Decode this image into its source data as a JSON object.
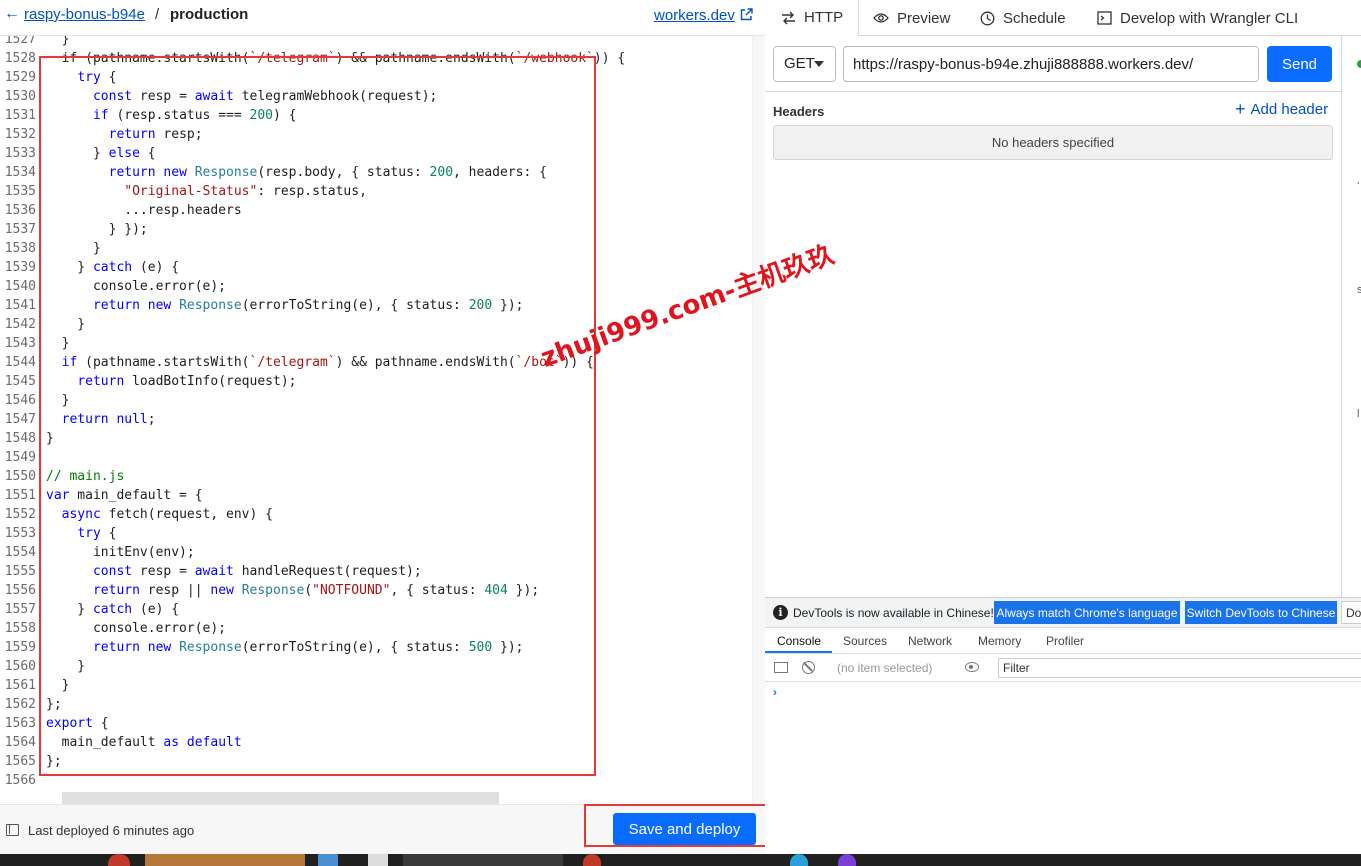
{
  "editor": {
    "worker_name": "raspy-bonus-b94e",
    "breadcrumb_separator": "/",
    "environment": "production",
    "workers_dev_link": "workers.dev",
    "lines": [
      {
        "n": "1527",
        "segs": [
          [
            "  }",
            "t"
          ]
        ]
      },
      {
        "n": "1528",
        "segs": [
          [
            "  if (pathname.startsWith(",
            "t"
          ],
          [
            "`/telegram`",
            "s"
          ],
          [
            ") && pathname.endsWith(",
            "t"
          ],
          [
            "`/webhook`",
            "s"
          ],
          [
            ")) {",
            "t"
          ]
        ]
      },
      {
        "n": "1529",
        "segs": [
          [
            "    ",
            "t"
          ],
          [
            "try",
            "k"
          ],
          [
            " {",
            "t"
          ]
        ]
      },
      {
        "n": "1530",
        "segs": [
          [
            "      ",
            "t"
          ],
          [
            "const",
            "k"
          ],
          [
            " resp = ",
            "t"
          ],
          [
            "await",
            "k"
          ],
          [
            " telegramWebhook(request);",
            "t"
          ]
        ]
      },
      {
        "n": "1531",
        "segs": [
          [
            "      ",
            "t"
          ],
          [
            "if",
            "k"
          ],
          [
            " (resp.status === ",
            "t"
          ],
          [
            "200",
            "n"
          ],
          [
            ") {",
            "t"
          ]
        ]
      },
      {
        "n": "1532",
        "segs": [
          [
            "        ",
            "t"
          ],
          [
            "return",
            "k"
          ],
          [
            " resp;",
            "t"
          ]
        ]
      },
      {
        "n": "1533",
        "segs": [
          [
            "      } ",
            "t"
          ],
          [
            "else",
            "k"
          ],
          [
            " {",
            "t"
          ]
        ]
      },
      {
        "n": "1534",
        "segs": [
          [
            "        ",
            "t"
          ],
          [
            "return",
            "k"
          ],
          [
            " ",
            "t"
          ],
          [
            "new",
            "k"
          ],
          [
            " ",
            "t"
          ],
          [
            "Response",
            "c"
          ],
          [
            "(resp.body, { status: ",
            "t"
          ],
          [
            "200",
            "n"
          ],
          [
            ", headers: {",
            "t"
          ]
        ]
      },
      {
        "n": "1535",
        "segs": [
          [
            "          ",
            "t"
          ],
          [
            "\"Original-Status\"",
            "s"
          ],
          [
            ": resp.status,",
            "t"
          ]
        ]
      },
      {
        "n": "1536",
        "segs": [
          [
            "          ...resp.headers",
            "t"
          ]
        ]
      },
      {
        "n": "1537",
        "segs": [
          [
            "        } });",
            "t"
          ]
        ]
      },
      {
        "n": "1538",
        "segs": [
          [
            "      }",
            "t"
          ]
        ]
      },
      {
        "n": "1539",
        "segs": [
          [
            "    } ",
            "t"
          ],
          [
            "catch",
            "k"
          ],
          [
            " (e) {",
            "t"
          ]
        ]
      },
      {
        "n": "1540",
        "segs": [
          [
            "      console.error(e);",
            "t"
          ]
        ]
      },
      {
        "n": "1541",
        "segs": [
          [
            "      ",
            "t"
          ],
          [
            "return",
            "k"
          ],
          [
            " ",
            "t"
          ],
          [
            "new",
            "k"
          ],
          [
            " ",
            "t"
          ],
          [
            "Response",
            "c"
          ],
          [
            "(errorToString(e), { status: ",
            "t"
          ],
          [
            "200",
            "n"
          ],
          [
            " });",
            "t"
          ]
        ]
      },
      {
        "n": "1542",
        "segs": [
          [
            "    }",
            "t"
          ]
        ]
      },
      {
        "n": "1543",
        "segs": [
          [
            "  }",
            "t"
          ]
        ]
      },
      {
        "n": "1544",
        "segs": [
          [
            "  ",
            "t"
          ],
          [
            "if",
            "k"
          ],
          [
            " (pathname.startsWith(",
            "t"
          ],
          [
            "`/telegram`",
            "s"
          ],
          [
            ") && pathname.endsWith(",
            "t"
          ],
          [
            "`/bot`",
            "s"
          ],
          [
            ")) {",
            "t"
          ]
        ]
      },
      {
        "n": "1545",
        "segs": [
          [
            "    ",
            "t"
          ],
          [
            "return",
            "k"
          ],
          [
            " loadBotInfo(request);",
            "t"
          ]
        ]
      },
      {
        "n": "1546",
        "segs": [
          [
            "  }",
            "t"
          ]
        ]
      },
      {
        "n": "1547",
        "segs": [
          [
            "  ",
            "t"
          ],
          [
            "return",
            "k"
          ],
          [
            " ",
            "t"
          ],
          [
            "null",
            "k"
          ],
          [
            ";",
            "t"
          ]
        ]
      },
      {
        "n": "1548",
        "segs": [
          [
            "}",
            "t"
          ]
        ]
      },
      {
        "n": "1549",
        "segs": [
          [
            "",
            "t"
          ]
        ]
      },
      {
        "n": "1550",
        "segs": [
          [
            "// main.js",
            "m"
          ]
        ]
      },
      {
        "n": "1551",
        "segs": [
          [
            "var",
            "k"
          ],
          [
            " main_default = {",
            "t"
          ]
        ]
      },
      {
        "n": "1552",
        "segs": [
          [
            "  ",
            "t"
          ],
          [
            "async",
            "k"
          ],
          [
            " fetch(request, env) {",
            "t"
          ]
        ]
      },
      {
        "n": "1553",
        "segs": [
          [
            "    ",
            "t"
          ],
          [
            "try",
            "k"
          ],
          [
            " {",
            "t"
          ]
        ]
      },
      {
        "n": "1554",
        "segs": [
          [
            "      initEnv(env);",
            "t"
          ]
        ]
      },
      {
        "n": "1555",
        "segs": [
          [
            "      ",
            "t"
          ],
          [
            "const",
            "k"
          ],
          [
            " resp = ",
            "t"
          ],
          [
            "await",
            "k"
          ],
          [
            " handleRequest(request);",
            "t"
          ]
        ]
      },
      {
        "n": "1556",
        "segs": [
          [
            "      ",
            "t"
          ],
          [
            "return",
            "k"
          ],
          [
            " resp || ",
            "t"
          ],
          [
            "new",
            "k"
          ],
          [
            " ",
            "t"
          ],
          [
            "Response",
            "c"
          ],
          [
            "(",
            "t"
          ],
          [
            "\"NOTFOUND\"",
            "s"
          ],
          [
            ", { status: ",
            "t"
          ],
          [
            "404",
            "n"
          ],
          [
            " });",
            "t"
          ]
        ]
      },
      {
        "n": "1557",
        "segs": [
          [
            "    } ",
            "t"
          ],
          [
            "catch",
            "k"
          ],
          [
            " (e) {",
            "t"
          ]
        ]
      },
      {
        "n": "1558",
        "segs": [
          [
            "      console.error(e);",
            "t"
          ]
        ]
      },
      {
        "n": "1559",
        "segs": [
          [
            "      ",
            "t"
          ],
          [
            "return",
            "k"
          ],
          [
            " ",
            "t"
          ],
          [
            "new",
            "k"
          ],
          [
            " ",
            "t"
          ],
          [
            "Response",
            "c"
          ],
          [
            "(errorToString(e), { status: ",
            "t"
          ],
          [
            "500",
            "n"
          ],
          [
            " });",
            "t"
          ]
        ]
      },
      {
        "n": "1560",
        "segs": [
          [
            "    }",
            "t"
          ]
        ]
      },
      {
        "n": "1561",
        "segs": [
          [
            "  }",
            "t"
          ]
        ]
      },
      {
        "n": "1562",
        "segs": [
          [
            "};",
            "t"
          ]
        ]
      },
      {
        "n": "1563",
        "segs": [
          [
            "export",
            "k"
          ],
          [
            " {",
            "t"
          ]
        ]
      },
      {
        "n": "1564",
        "segs": [
          [
            "  main_default ",
            "t"
          ],
          [
            "as",
            "k"
          ],
          [
            " ",
            "t"
          ],
          [
            "default",
            "k"
          ]
        ]
      },
      {
        "n": "1565",
        "segs": [
          [
            "};",
            "t"
          ]
        ]
      },
      {
        "n": "1566",
        "segs": [
          [
            "",
            "t"
          ]
        ]
      }
    ],
    "syntax_colors": {
      "t": "#1e1e1e",
      "k": "#0000ff",
      "s": "#a31515",
      "n": "#098658",
      "c": "#267f99",
      "m": "#008000"
    },
    "footer_status": "Last deployed 6 minutes ago",
    "save_deploy_label": "Save and deploy"
  },
  "watermark": "zhuji999.com-主机玖玖",
  "http_panel": {
    "tabs": [
      "HTTP",
      "Preview",
      "Schedule",
      "Develop with Wrangler CLI"
    ],
    "method": "GET",
    "url": "https://raspy-bonus-b94e.zhuji888888.workers.dev/",
    "send_label": "Send",
    "headers_label": "Headers",
    "add_header_label": "Add header",
    "no_headers_text": "No headers specified"
  },
  "devtools": {
    "notice": "DevTools is now available in Chinese!",
    "match_button": "Always match Chrome's language",
    "switch_button": "Switch DevTools to Chinese",
    "dont_button": "Don't show again",
    "tabs": [
      "Console",
      "Sources",
      "Network",
      "Memory",
      "Profiler"
    ],
    "context_selector": "(no item selected)",
    "filter_placeholder": "Filter",
    "prompt": "›"
  },
  "colors": {
    "accent": "#0a6cff",
    "link": "#0051c3",
    "highlight_border": "#e53935",
    "watermark": "#e1141e"
  }
}
